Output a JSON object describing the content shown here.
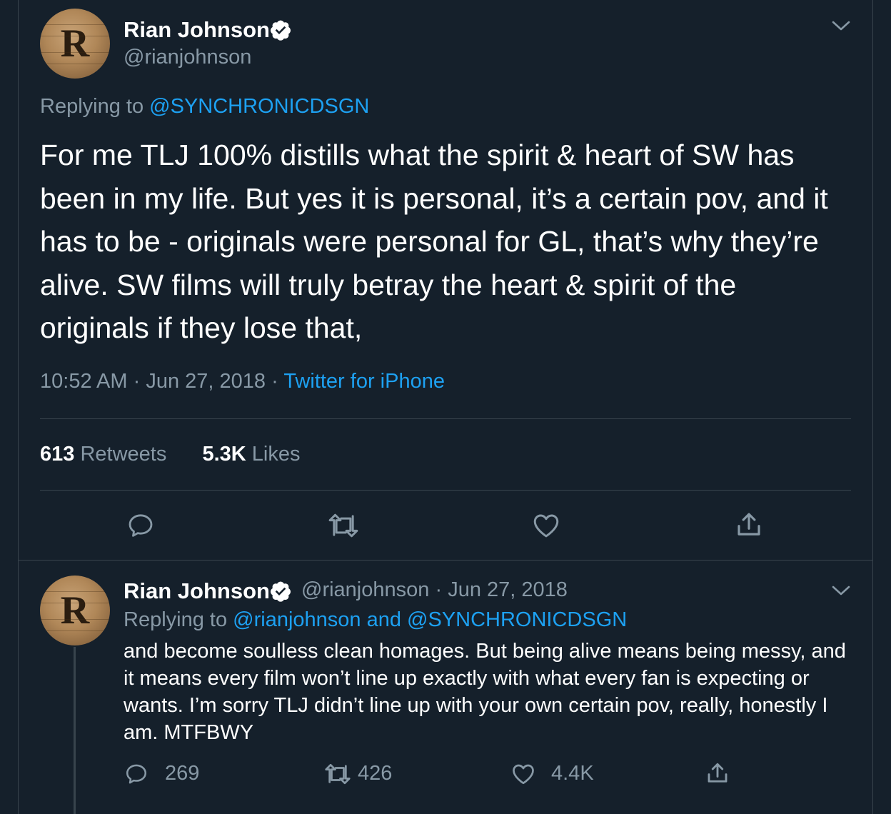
{
  "main_tweet": {
    "author_name": "Rian Johnson",
    "author_handle": "@rianjohnson",
    "avatar_letter": "R",
    "replying_prefix": "Replying to",
    "replying_to": "@SYNCHRONICDSGN",
    "text": "For me TLJ 100% distills what the spirit & heart of SW has been in my life. But yes it is personal, it’s a certain pov, and it has to be - originals were personal for GL, that’s why they’re alive. SW films will truly betray the heart & spirit of the originals if they lose that,",
    "time": "10:52 AM",
    "separator": "·",
    "date": "Jun 27, 2018",
    "source": "Twitter for iPhone",
    "retweets_count": "613",
    "retweets_label": "Retweets",
    "likes_count": "5.3K",
    "likes_label": "Likes"
  },
  "reply_tweet": {
    "author_name": "Rian Johnson",
    "author_handle": "@rianjohnson",
    "separator": "·",
    "date": "Jun 27, 2018",
    "avatar_letter": "R",
    "replying_prefix": "Replying to",
    "replying_to": "@rianjohnson and @SYNCHRONICDSGN",
    "text": "and become soulless clean homages. But being alive means being messy, and it means every film won’t line up exactly with what every fan is expecting or wants. I’m sorry TLJ didn’t line up with your own certain pov, really, honestly I am. MTFBWY",
    "reply_count": "269",
    "retweet_count": "426",
    "like_count": "4.4K"
  },
  "icons": {
    "verified": "verified-badge-icon",
    "chevron": "chevron-down-icon",
    "reply": "reply-bubble-icon",
    "retweet": "retweet-icon",
    "like": "heart-icon",
    "share": "share-icon"
  },
  "colors": {
    "background": "#15202b",
    "text_secondary": "#8899a6",
    "link": "#1da1f2",
    "divider": "#38444d"
  }
}
